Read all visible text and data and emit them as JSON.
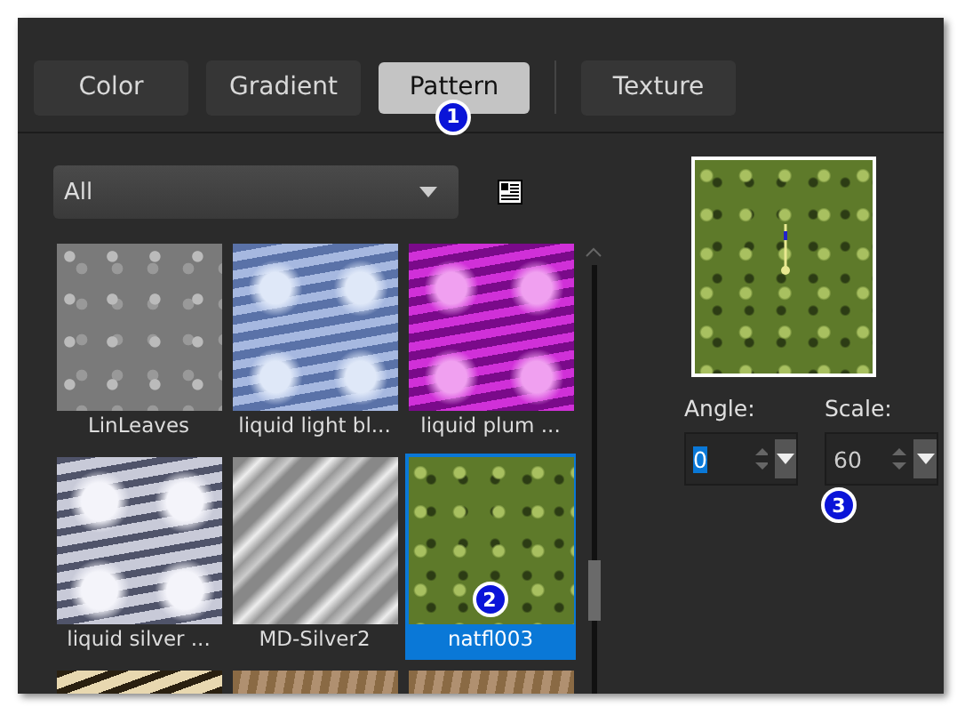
{
  "tabs": [
    {
      "label": "Color",
      "selected": false
    },
    {
      "label": "Gradient",
      "selected": false
    },
    {
      "label": "Pattern",
      "selected": true,
      "callout": "1"
    },
    {
      "label": "Texture",
      "selected": false
    }
  ],
  "category_dropdown": {
    "value": "All"
  },
  "patterns": [
    {
      "label": "LinLeaves",
      "kind": "gray",
      "selected": false
    },
    {
      "label": "liquid light bl...",
      "kind": "blue",
      "selected": false
    },
    {
      "label": "liquid plum ...",
      "kind": "plum",
      "selected": false
    },
    {
      "label": "liquid silver ...",
      "kind": "silver",
      "selected": false
    },
    {
      "label": "MD-Silver2",
      "kind": "stripes",
      "selected": false
    },
    {
      "label": "natfl003",
      "kind": "leaves",
      "selected": true,
      "callout": "2"
    },
    {
      "kind": "zebra",
      "selected": false
    },
    {
      "kind": "tan",
      "selected": false
    },
    {
      "kind": "tan",
      "selected": false
    }
  ],
  "preview": {
    "kind": "leaves"
  },
  "fields": [
    {
      "label": "Angle:",
      "value": "0",
      "text_selected": true
    },
    {
      "label": "Scale:",
      "value": "60",
      "text_selected": false,
      "callout": "3"
    }
  ]
}
